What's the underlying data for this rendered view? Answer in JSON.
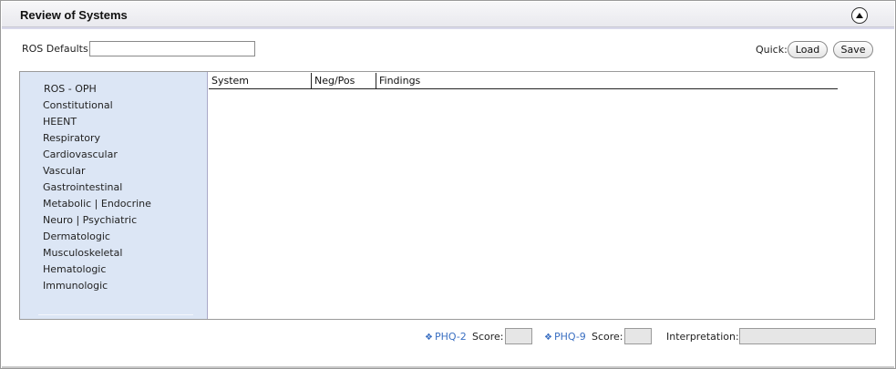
{
  "panel": {
    "title": "Review of Systems",
    "collapse_icon": "chevron-up-circle-icon"
  },
  "ros_defaults": {
    "label": "ROS Defaults:",
    "value": ""
  },
  "quick": {
    "label": "Quick:",
    "load_label": "Load",
    "save_label": "Save"
  },
  "sidebar": {
    "items": [
      "ROS - OPH",
      "Constitutional",
      "HEENT",
      "Respiratory",
      "Cardiovascular",
      "Vascular",
      "Gastrointestinal",
      "Metabolic | Endocrine",
      "Neuro | Psychiatric",
      "Dermatologic",
      "Musculoskeletal",
      "Hematologic",
      "Immunologic"
    ]
  },
  "grid": {
    "columns": [
      "System",
      "Neg/Pos",
      "Findings"
    ]
  },
  "footer": {
    "phq2_link": "PHQ-2",
    "phq2_score_label": "Score:",
    "phq2_score": "",
    "phq9_link": "PHQ-9",
    "phq9_score_label": "Score:",
    "phq9_score": "",
    "interpretation_label": "Interpretation:",
    "interpretation": "",
    "link_icon": "diamond-bullet-icon"
  },
  "colors": {
    "sidebar_bg": "#dce6f5",
    "link": "#3a6fc2",
    "header_bg": "#efeff3"
  }
}
